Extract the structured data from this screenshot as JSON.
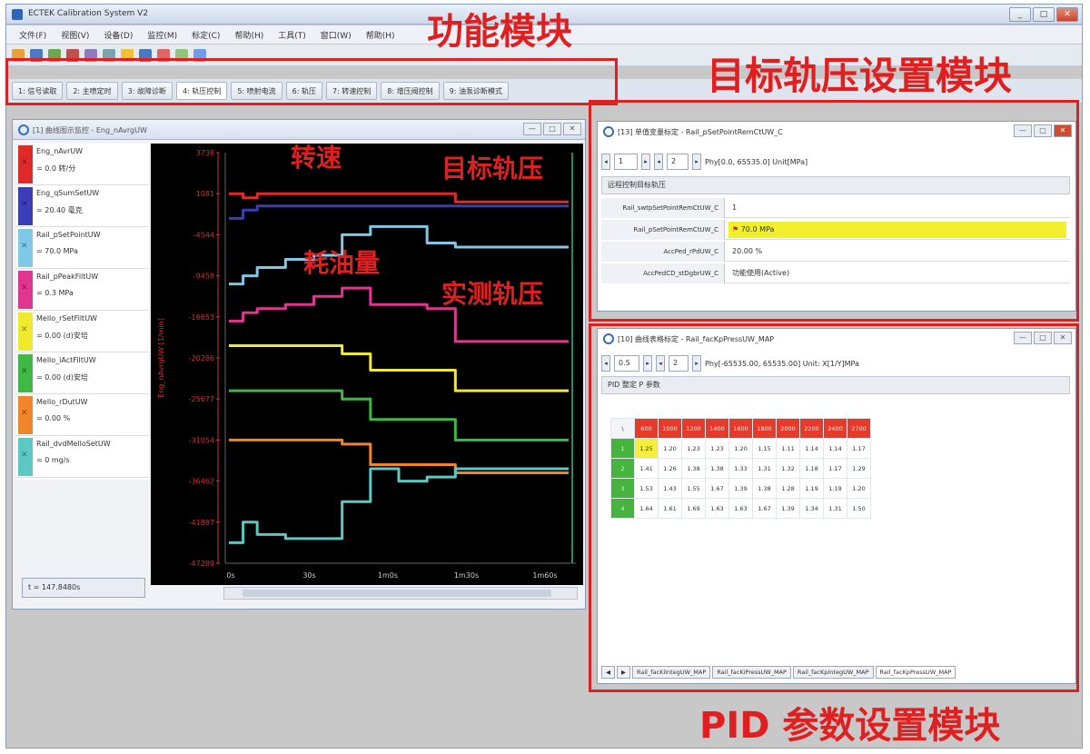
{
  "app": {
    "title": "ECTEK Calibration System V2",
    "window_buttons": [
      "_",
      "□",
      "✕"
    ]
  },
  "menu": [
    "文件(F)",
    "视图(V)",
    "设备(D)",
    "监控(M)",
    "标定(C)",
    "帮助(H)",
    "工具(T)",
    "窗口(W)",
    "帮助(H)"
  ],
  "function_tabs": [
    {
      "label": "1: 信号读取"
    },
    {
      "label": "2: 主喷定时"
    },
    {
      "label": "3: 故障诊断"
    },
    {
      "label": "4: 轨压控制",
      "active": true
    },
    {
      "label": "5: 喷射电流"
    },
    {
      "label": "6: 轨压"
    },
    {
      "label": "7: 转速控制"
    },
    {
      "label": "8: 增压阀控制"
    },
    {
      "label": "9: 油泵诊断模式"
    }
  ],
  "annotations": {
    "function_module": "功能模块",
    "target_rail_module": "目标轨压设置模块",
    "pid_module": "PID 参数设置模块",
    "speed": "转速",
    "target_rail": "目标轨压",
    "fuel_consumption": "耗油量",
    "measured_rail": "实测轨压"
  },
  "graph_window": {
    "title": "[1] 曲线图示监控 - Eng_nAvrgUW",
    "buttons": [
      "—",
      "□",
      "✕"
    ],
    "signals": [
      {
        "name": "Eng_nAvrUW",
        "value": "= 0.0 转/分",
        "color": "#e02a2a"
      },
      {
        "name": "Eng_qSumSetUW",
        "value": "= 20.40 毫克",
        "color": "#3b3fb5"
      },
      {
        "name": "Rail_pSetPointUW",
        "value": "= 70.0 MPa",
        "color": "#7fc8e6"
      },
      {
        "name": "Rail_pPeakFiltUW",
        "value": "= 0.3 MPa",
        "color": "#e0368f"
      },
      {
        "name": "Mello_rSetFiltUW",
        "value": "= 0.00 (d)安培",
        "color": "#f0ea2e"
      },
      {
        "name": "Mello_iActFiltUW",
        "value": "= 0.00 (d)安培",
        "color": "#3fb845"
      },
      {
        "name": "Mello_rDutUW",
        "value": "= 0.00 %",
        "color": "#f0852a"
      },
      {
        "name": "Rail_dvdMelloSetUW",
        "value": "= 0 mg/s",
        "color": "#5cc8c4"
      }
    ],
    "time_readout": "t = 147.8480s",
    "y_axis_label": "Eng_nAvrgUW [1/min]",
    "y_ticks": [
      "3738",
      "1081",
      "-4544",
      "-9458",
      "-16653",
      "-20286",
      "-25677",
      "-31054",
      "-36462",
      "-41887",
      "-47289"
    ],
    "x_ticks": [
      "0s",
      "30s",
      "1m0s",
      "1m30s",
      "1m60s"
    ]
  },
  "target_window": {
    "title": "[13] 单值变量标定 - Rail_pSetPointRemCtUW_C",
    "buttons": [
      "—",
      "□",
      "✕"
    ],
    "spin1": "1",
    "spin2": "2",
    "phy_range": "Phy[0.0, 65535.0]  Unit[MPa]",
    "header": "远程控制目标轨压",
    "params": [
      {
        "name": "Rail_swtpSetPointRemCtUW_C",
        "value": "1",
        "highlight": false
      },
      {
        "name": "Rail_pSetPointRemCtUW_C",
        "value": "70.0 MPa",
        "highlight": true
      },
      {
        "name": "AccPed_rPdUW_C",
        "value": "20.00 %",
        "highlight": false
      },
      {
        "name": "AccPedCD_stDgbrUW_C",
        "value": "功能使用(Active)",
        "highlight": false
      }
    ]
  },
  "pid_window": {
    "title": "[10] 曲线表格标定 - Rail_facKpPressUW_MAP",
    "buttons": [
      "—",
      "□",
      "✕"
    ],
    "spin1": "0.5",
    "spin2": "2",
    "phy_range": "Phy[-65535.00, 65535.00]  Unit: X[1/Y]MPa",
    "header": "PID 整定 P 参数",
    "corner": "\\",
    "col_headers": [
      "600",
      "1000",
      "1200",
      "1400",
      "1600",
      "1800",
      "2000",
      "2200",
      "2400",
      "2700"
    ],
    "rows": [
      {
        "label": "1",
        "values": [
          "1.25",
          "1.20",
          "1.23",
          "1.23",
          "1.20",
          "1.15",
          "1.11",
          "1.14",
          "1.14",
          "1.17"
        ]
      },
      {
        "label": "2",
        "values": [
          "1.41",
          "1.26",
          "1.38",
          "1.38",
          "1.33",
          "1.31",
          "1.32",
          "1.18",
          "1.17",
          "1.29"
        ]
      },
      {
        "label": "3",
        "values": [
          "1.53",
          "1.43",
          "1.55",
          "1.67",
          "1.39",
          "1.38",
          "1.28",
          "1.19",
          "1.19",
          "1.20"
        ]
      },
      {
        "label": "4",
        "values": [
          "1.64",
          "1.61",
          "1.69",
          "1.63",
          "1.63",
          "1.67",
          "1.39",
          "1.34",
          "1.31",
          "1.50"
        ]
      }
    ],
    "sheet_tabs": [
      "Rail_facKiIntegUW_MAP",
      "Rail_facKiPressUW_MAP",
      "Rail_facKpIntegUW_MAP",
      "Rail_facKpPressUW_MAP"
    ],
    "nav_arrows": [
      "◀",
      "▶"
    ]
  },
  "chart_data": {
    "type": "line",
    "x": [
      0,
      5,
      10,
      20,
      30,
      40,
      50,
      60,
      70,
      80,
      90,
      100,
      110,
      120
    ],
    "xlabel": "",
    "ylabel": "Eng_nAvrgUW [1/min]",
    "series": [
      {
        "color": "#e02a2a",
        "values": [
          0.1,
          0.11,
          0.1,
          0.1,
          0.1,
          0.1,
          0.1,
          0.1,
          0.1,
          0.12,
          0.12,
          0.12,
          0.12,
          0.12
        ]
      },
      {
        "color": "#3b3fb5",
        "values": [
          0.16,
          0.14,
          0.13,
          0.13,
          0.13,
          0.13,
          0.13,
          0.13,
          0.13,
          0.13,
          0.13,
          0.13,
          0.13,
          0.13
        ]
      },
      {
        "color": "#7fc8e6",
        "values": [
          0.32,
          0.3,
          0.28,
          0.26,
          0.25,
          0.2,
          0.18,
          0.18,
          0.22,
          0.23,
          0.23,
          0.23,
          0.23,
          0.23
        ]
      },
      {
        "color": "#e0368f",
        "values": [
          0.41,
          0.39,
          0.38,
          0.37,
          0.35,
          0.33,
          0.37,
          0.37,
          0.38,
          0.46,
          0.46,
          0.46,
          0.46,
          0.46
        ]
      },
      {
        "color": "#f0ea2e",
        "values": [
          0.47,
          0.47,
          0.47,
          0.47,
          0.47,
          0.49,
          0.53,
          0.53,
          0.53,
          0.58,
          0.58,
          0.58,
          0.58,
          0.58
        ]
      },
      {
        "color": "#3fb845",
        "values": [
          0.58,
          0.58,
          0.58,
          0.58,
          0.58,
          0.6,
          0.65,
          0.65,
          0.65,
          0.7,
          0.7,
          0.7,
          0.7,
          0.7
        ]
      },
      {
        "color": "#f0852a",
        "values": [
          0.7,
          0.7,
          0.7,
          0.7,
          0.7,
          0.71,
          0.76,
          0.76,
          0.76,
          0.78,
          0.78,
          0.78,
          0.78,
          0.78
        ]
      },
      {
        "color": "#5cc8c4",
        "values": [
          0.95,
          0.9,
          0.93,
          0.94,
          0.94,
          0.85,
          0.77,
          0.8,
          0.79,
          0.77,
          0.77,
          0.77,
          0.77,
          0.77
        ]
      }
    ],
    "ylim": [
      0,
      1
    ],
    "xlim": [
      0,
      120
    ],
    "grid": false
  }
}
